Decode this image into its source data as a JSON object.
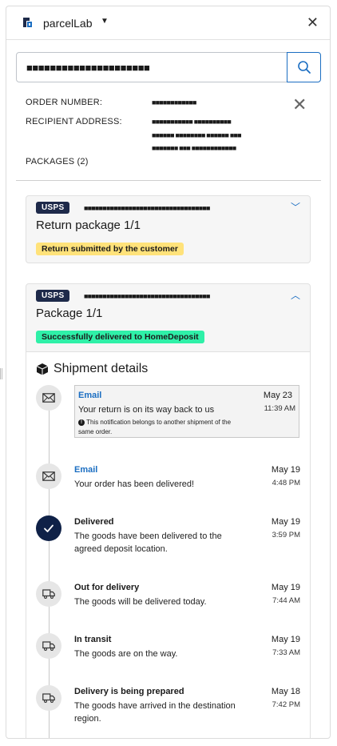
{
  "header": {
    "brand": "parcelLab"
  },
  "search": {
    "value": "■■■■■■■■■■■■■■■■■■■■■"
  },
  "order": {
    "order_number_label": "ORDER NUMBER:",
    "order_number_value": "■■■■■■■■■■■■",
    "recipient_label": "RECIPIENT ADDRESS:",
    "recipient_line1": "■■■■■■■■■■■  ■■■■■■■■■■",
    "recipient_line2": "■■■■■■  ■■■■■■■■  ■■■■■■  ■■■",
    "recipient_line3": "■■■■■■■  ■■■  ■■■■■■■■■■■■",
    "packages_label": "PACKAGES (2)"
  },
  "packages": [
    {
      "carrier": "USPS",
      "tracking": "■■■■■■■■■■■■■■■■■■■■■■■■■■■■■■■■■■",
      "title": "Return package 1/1",
      "status": "Return submitted by the customer",
      "status_color": "#ffe27a"
    },
    {
      "carrier": "USPS",
      "tracking": "■■■■■■■■■■■■■■■■■■■■■■■■■■■■■■■■■■",
      "title": "Package 1/1",
      "status": "Successfully delivered to HomeDeposit",
      "status_color": "#2ff0a8"
    }
  ],
  "details": {
    "title": "Shipment details",
    "events": [
      {
        "type": "Email",
        "desc": "Your return is on its way back to us",
        "note": "This notification belongs to another shipment of the same order.",
        "date": "May 23",
        "time": "11:39 AM",
        "icon": "envelope-icon"
      },
      {
        "type": "Email",
        "desc": "Your order has been delivered!",
        "date": "May 19",
        "time": "4:48 PM",
        "icon": "envelope-icon"
      },
      {
        "type": "Delivered",
        "desc": "The goods have been delivered to the agreed deposit location.",
        "date": "May 19",
        "time": "3:59 PM",
        "icon": "checkmark-icon"
      },
      {
        "type": "Out for delivery",
        "desc": "The goods will be delivered today.",
        "date": "May 19",
        "time": "7:44 AM",
        "icon": "truck-icon"
      },
      {
        "type": "In transit",
        "desc": "The goods are on the way.",
        "date": "May 19",
        "time": "7:33 AM",
        "icon": "truck-icon"
      },
      {
        "type": "Delivery is being prepared",
        "desc": "The goods have arrived in the destination region.",
        "date": "May 18",
        "time": "7:42 PM",
        "icon": "truck-icon"
      }
    ]
  },
  "colors": {
    "accent": "#1b6ec2",
    "carrier_badge": "#1e2a4a",
    "active_step": "#0f2147"
  }
}
